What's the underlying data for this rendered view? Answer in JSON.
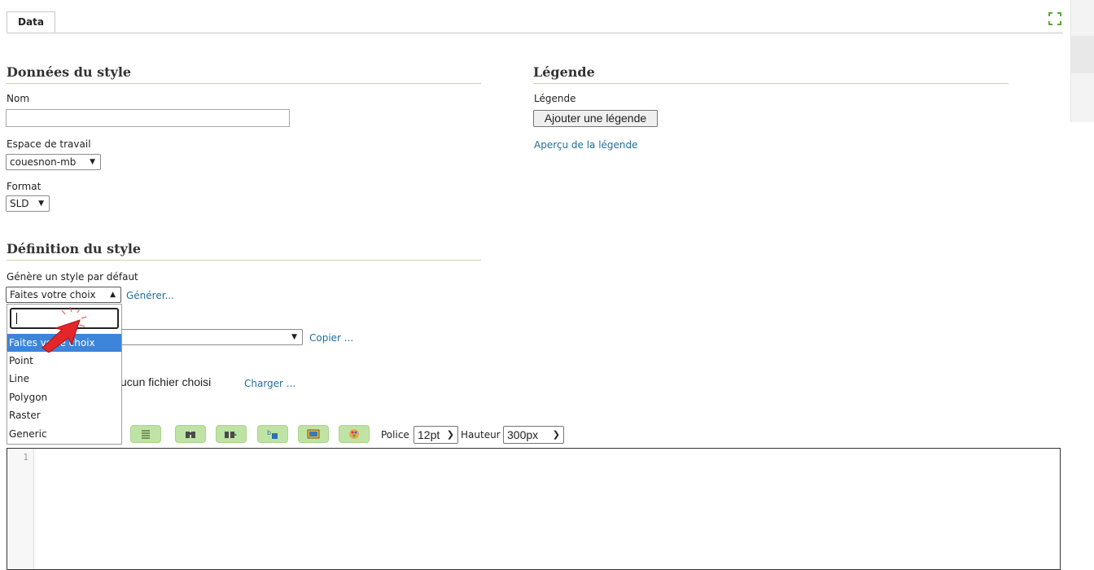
{
  "tabs": {
    "data_tab": "Data"
  },
  "style_data": {
    "heading": "Données du style",
    "name_label": "Nom",
    "name_value": "",
    "workspace_label": "Espace de travail",
    "workspace_value": "couesnon-mb",
    "format_label": "Format",
    "format_value": "SLD"
  },
  "legend": {
    "heading": "Légende",
    "label": "Légende",
    "add_button": "Ajouter une légende",
    "preview_link": "Aperçu de la légende"
  },
  "style_definition": {
    "heading": "Définition du style",
    "generate_label": "Génère un style par défaut",
    "generate_select_value": "Faites votre choix",
    "generate_link": "Générer...",
    "copy_link": "Copier ...",
    "file_status": "ucun fichier choisi",
    "upload_link": "Charger ...",
    "dropdown_options": [
      "Faites votre choix",
      "Point",
      "Line",
      "Polygon",
      "Raster",
      "Generic"
    ],
    "dropdown_selected_index": 0
  },
  "toolbar": {
    "font_label": "Police",
    "font_value": "12pt",
    "height_label": "Hauteur",
    "height_value": "300px"
  },
  "editor": {
    "line_number": "1"
  }
}
